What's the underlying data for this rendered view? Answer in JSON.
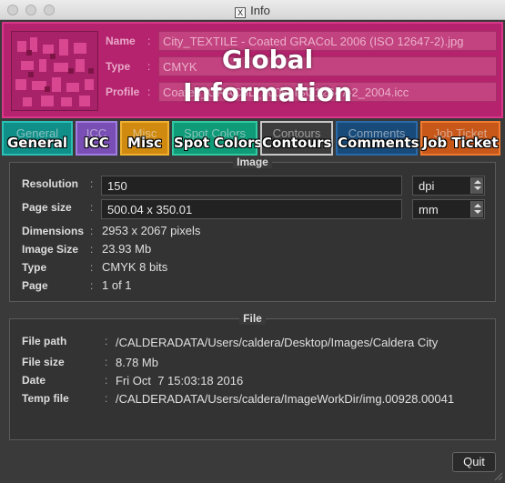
{
  "window": {
    "title": "Info"
  },
  "global": {
    "overlay_title": "Global Information",
    "fields": [
      {
        "label": "Name",
        "value": "City_TEXTILE - Coated GRACoL 2006 (ISO 12647-2).jpg"
      },
      {
        "label": "Type",
        "value": "CMYK"
      },
      {
        "label": "Profile",
        "value": "Coated_GRACoL_2006_ISO12647-2_2004.icc"
      }
    ],
    "color": "#b5236e"
  },
  "tabs": [
    {
      "label": "General",
      "color": "#0f8f88"
    },
    {
      "label": "ICC",
      "color": "#7a4fb5"
    },
    {
      "label": "Misc",
      "color": "#d08a10"
    },
    {
      "label": "Spot Colors",
      "color": "#0f9a78"
    },
    {
      "label": "Contours",
      "color": "#a0a0a0"
    },
    {
      "label": "Comments",
      "color": "#184a7a"
    },
    {
      "label": "Job Ticket",
      "color": "#c8571a"
    }
  ],
  "image": {
    "title": "Image",
    "resolution_label": "Resolution",
    "resolution_value": "150",
    "resolution_unit": "dpi",
    "pagesize_label": "Page size",
    "pagesize_value": "500.04 x 350.01",
    "pagesize_unit": "mm",
    "rows": [
      {
        "label": "Dimensions",
        "value": "2953 x 2067 pixels"
      },
      {
        "label": "Image Size",
        "value": "23.93 Mb"
      },
      {
        "label": "Type",
        "value": "CMYK 8 bits"
      },
      {
        "label": "Page",
        "value": "1 of 1"
      }
    ]
  },
  "file": {
    "title": "File",
    "rows": [
      {
        "label": "File path",
        "value": "/CALDERADATA/Users/caldera/Desktop/Images/Caldera City"
      },
      {
        "label": "File size",
        "value": "8.78 Mb"
      },
      {
        "label": "Date",
        "value": "Fri Oct  7 15:03:18 2016"
      },
      {
        "label": "Temp file",
        "value": "/CALDERADATA/Users/caldera/ImageWorkDir/img.00928.00041"
      }
    ]
  },
  "quit_label": "Quit"
}
